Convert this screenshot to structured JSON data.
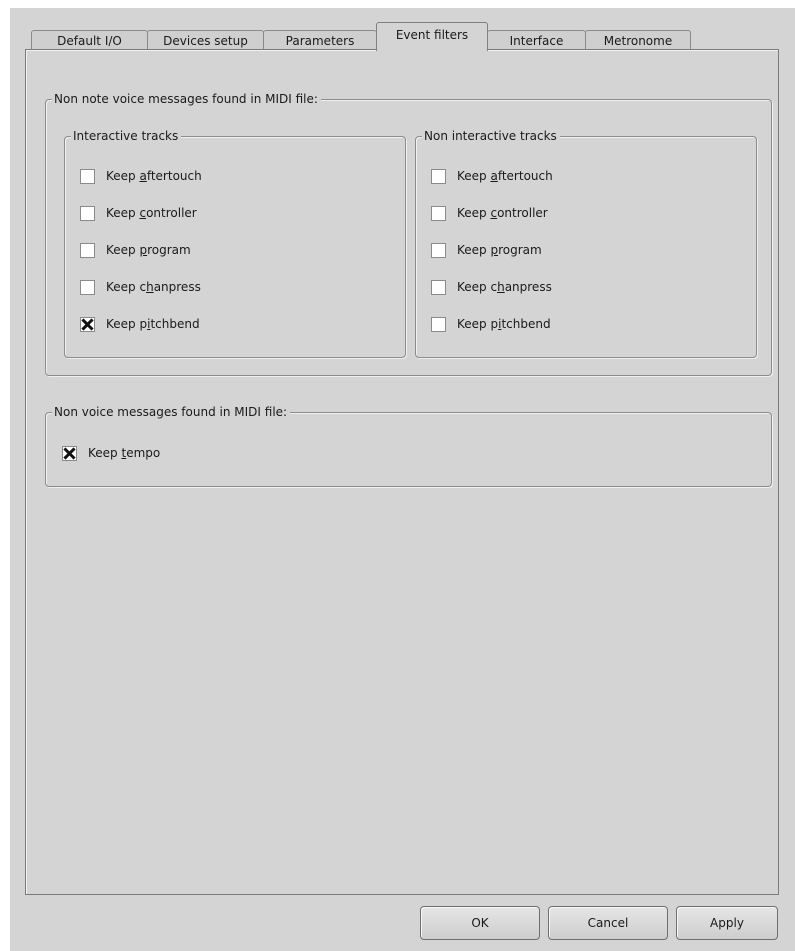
{
  "tabs": [
    {
      "label": "Default I/O",
      "active": false
    },
    {
      "label": "Devices setup",
      "active": false
    },
    {
      "label": "Parameters",
      "active": false
    },
    {
      "label": "Event filters",
      "active": true
    },
    {
      "label": "Interface",
      "active": false
    },
    {
      "label": "Metronome",
      "active": false
    }
  ],
  "non_note_group": {
    "title": "Non note voice messages found in MIDI file:",
    "interactive": {
      "title": "Interactive tracks",
      "items": [
        {
          "pre": "Keep ",
          "key": "a",
          "post": "ftertouch",
          "checked": false
        },
        {
          "pre": "Keep ",
          "key": "c",
          "post": "ontroller",
          "checked": false
        },
        {
          "pre": "Keep ",
          "key": "p",
          "post": "rogram",
          "checked": false
        },
        {
          "pre": "Keep c",
          "key": "h",
          "post": "anpress",
          "checked": false
        },
        {
          "pre": "Keep p",
          "key": "i",
          "post": "tchbend",
          "checked": true
        }
      ]
    },
    "non_interactive": {
      "title": "Non interactive tracks",
      "items": [
        {
          "pre": "Keep ",
          "key": "a",
          "post": "ftertouch",
          "checked": false
        },
        {
          "pre": "Keep ",
          "key": "c",
          "post": "ontroller",
          "checked": false
        },
        {
          "pre": "Keep ",
          "key": "p",
          "post": "rogram",
          "checked": false
        },
        {
          "pre": "Keep c",
          "key": "h",
          "post": "anpress",
          "checked": false
        },
        {
          "pre": "Keep p",
          "key": "i",
          "post": "tchbend",
          "checked": false
        }
      ]
    }
  },
  "non_voice_group": {
    "title": "Non voice messages found in MIDI file:",
    "items": [
      {
        "pre": "Keep ",
        "key": "t",
        "post": "empo",
        "checked": true
      }
    ]
  },
  "buttons": {
    "ok": "OK",
    "cancel": "Cancel",
    "apply": "Apply"
  },
  "icons": {
    "check_mark": "x-mark-icon"
  }
}
